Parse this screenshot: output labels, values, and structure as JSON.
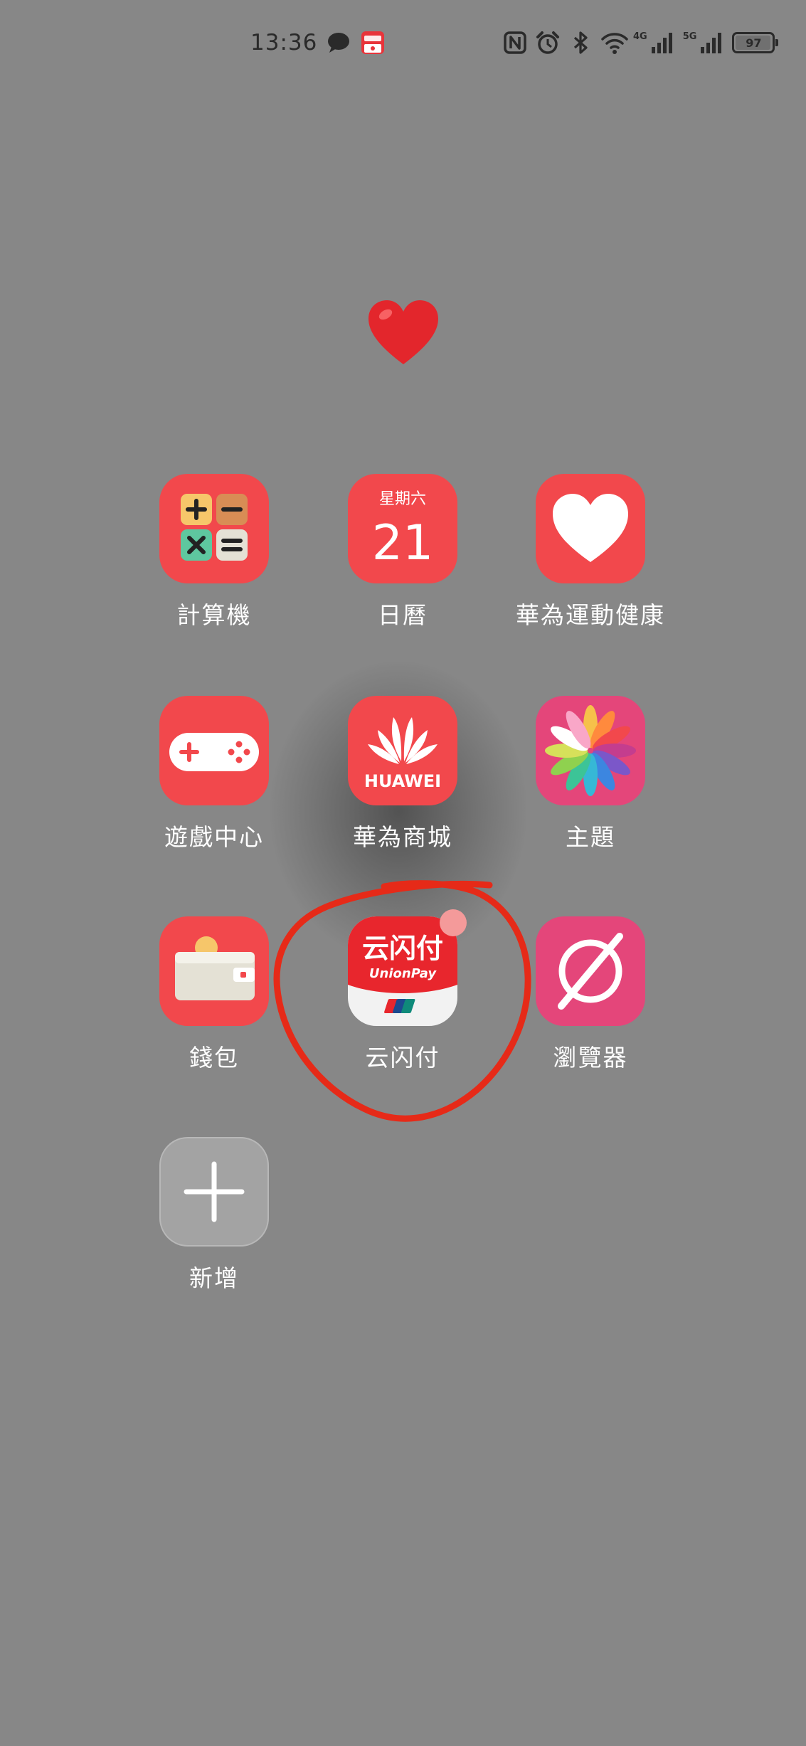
{
  "status_bar": {
    "time": "13:36",
    "left_icons": [
      "chat-bubble-icon",
      "app-notification-icon"
    ],
    "right_icons": [
      "nfc-icon",
      "alarm-icon",
      "bluetooth-icon",
      "wifi-icon",
      "cellular-4g-icon",
      "cellular-5g-icon",
      "battery-icon"
    ],
    "network_4g": "4G",
    "network_5g": "5G",
    "battery": "97",
    "battery_fraction": 0.97
  },
  "decoration": {
    "emoji": "red-heart-emoji"
  },
  "apps": [
    {
      "label": "計算機",
      "icon": "calculator-icon"
    },
    {
      "label": "日曆",
      "icon": "calendar-icon",
      "icon_text_weekday": "星期六",
      "icon_text_day": "21"
    },
    {
      "label": "華為運動健康",
      "icon": "health-heart-icon"
    },
    {
      "label": "遊戲中心",
      "icon": "gamepad-icon"
    },
    {
      "label": "華為商城",
      "icon": "huawei-logo-icon",
      "icon_text": "HUAWEI"
    },
    {
      "label": "主題",
      "icon": "themes-pinwheel-icon"
    },
    {
      "label": "錢包",
      "icon": "wallet-icon"
    },
    {
      "label": "云闪付",
      "icon": "unionpay-icon",
      "icon_text_top": "云闪付",
      "icon_text_brand": "UnionPay",
      "has_badge": true
    },
    {
      "label": "瀏覽器",
      "icon": "browser-compass-icon"
    },
    {
      "label": "新增",
      "icon": "add-plus-icon"
    }
  ],
  "colors": {
    "background": "#878787",
    "app_red": "#f2484c",
    "app_pink": "#e4467a",
    "annotation_red": "#e62a18",
    "badge": "#f49a9a"
  }
}
